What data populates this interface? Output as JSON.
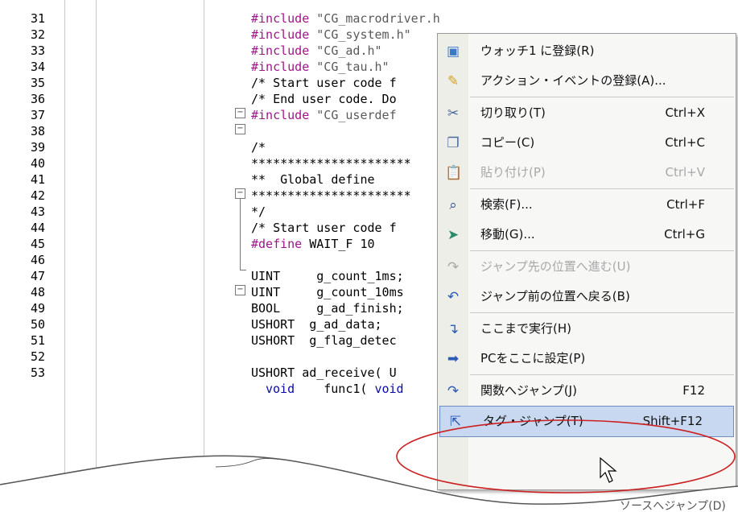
{
  "editor": {
    "lines": [
      {
        "num": "31",
        "segments": [
          {
            "t": "#include ",
            "c": "pp"
          },
          {
            "t": "\"CG_macrodriver.h\"",
            "c": "str"
          }
        ]
      },
      {
        "num": "32",
        "segments": [
          {
            "t": "#include ",
            "c": "pp"
          },
          {
            "t": "\"CG_system.h\"",
            "c": "str"
          }
        ]
      },
      {
        "num": "33",
        "segments": [
          {
            "t": "#include ",
            "c": "pp"
          },
          {
            "t": "\"CG_ad.h\"",
            "c": "str"
          }
        ]
      },
      {
        "num": "34",
        "segments": [
          {
            "t": "#include ",
            "c": "pp"
          },
          {
            "t": "\"CG_tau.h\"",
            "c": "str"
          }
        ]
      },
      {
        "num": "35",
        "segments": [
          {
            "t": "/* Start user code f",
            "c": "cmt"
          }
        ]
      },
      {
        "num": "36",
        "segments": [
          {
            "t": "/* End user code. Do",
            "c": "cmt"
          }
        ]
      },
      {
        "num": "37",
        "segments": [
          {
            "t": "#include ",
            "c": "pp"
          },
          {
            "t": "\"CG_userdef",
            "c": "str"
          }
        ]
      },
      {
        "num": "38",
        "segments": []
      },
      {
        "num": "39",
        "segments": [
          {
            "t": "/*",
            "c": "cmt"
          }
        ]
      },
      {
        "num": "40",
        "segments": [
          {
            "t": "**********************",
            "c": "cmt"
          }
        ]
      },
      {
        "num": "41",
        "segments": [
          {
            "t": "**  Global define",
            "c": "cmt"
          }
        ]
      },
      {
        "num": "42",
        "segments": [
          {
            "t": "**********************",
            "c": "cmt"
          }
        ]
      },
      {
        "num": "43",
        "segments": [
          {
            "t": "*/",
            "c": "cmt"
          }
        ]
      },
      {
        "num": "44",
        "segments": [
          {
            "t": "/* Start user code f",
            "c": "cmt"
          }
        ]
      },
      {
        "num": "45",
        "segments": [
          {
            "t": "#define ",
            "c": "pp"
          },
          {
            "t": "WAIT_F 10",
            "c": "n"
          }
        ]
      },
      {
        "num": "46",
        "segments": []
      },
      {
        "num": "47",
        "segments": [
          {
            "t": "UINT     g_count_1ms;",
            "c": "n"
          }
        ]
      },
      {
        "num": "48",
        "segments": [
          {
            "t": "UINT     g_count_10ms",
            "c": "n"
          }
        ]
      },
      {
        "num": "49",
        "segments": [
          {
            "t": "BOOL     g_ad_finish;",
            "c": "n"
          }
        ]
      },
      {
        "num": "50",
        "segments": [
          {
            "t": "USHORT  g_ad_data;",
            "c": "n"
          }
        ]
      },
      {
        "num": "51",
        "segments": [
          {
            "t": "USHORT  g_flag_detec",
            "c": "n"
          }
        ]
      },
      {
        "num": "52",
        "segments": []
      },
      {
        "num": "53",
        "segments": [
          {
            "t": "USHORT ad_receive( U",
            "c": "n"
          }
        ]
      }
    ],
    "partial_line": {
      "segments": [
        {
          "t": "void",
          "c": "kw"
        },
        {
          "t": "    func1( ",
          "c": "n"
        },
        {
          "t": "void",
          "c": "kw"
        }
      ]
    }
  },
  "context_menu": {
    "items": [
      {
        "id": "watch",
        "icon": "watch-register-icon",
        "glyph": "▣",
        "color": "#3a78c8",
        "label": "ウォッチ1 に登録(R)",
        "shortcut": "",
        "disabled": false
      },
      {
        "id": "action",
        "icon": "action-event-icon",
        "glyph": "✎",
        "color": "#d4a020",
        "label": "アクション・イベントの登録(A)...",
        "shortcut": "",
        "disabled": false
      },
      {
        "sep": true
      },
      {
        "id": "cut",
        "icon": "cut-icon",
        "glyph": "✂",
        "color": "#4a6a9a",
        "label": "切り取り(T)",
        "shortcut": "Ctrl+X",
        "disabled": false
      },
      {
        "id": "copy",
        "icon": "copy-icon",
        "glyph": "❐",
        "color": "#4a6a9a",
        "label": "コピー(C)",
        "shortcut": "Ctrl+C",
        "disabled": false
      },
      {
        "id": "paste",
        "icon": "paste-icon",
        "glyph": "📋",
        "color": "#a8a8a8",
        "label": "貼り付け(P)",
        "shortcut": "Ctrl+V",
        "disabled": true
      },
      {
        "sep": true
      },
      {
        "id": "find",
        "icon": "find-icon",
        "glyph": "⌕",
        "color": "#2a4a8a",
        "label": "検索(F)...",
        "shortcut": "Ctrl+F",
        "disabled": false
      },
      {
        "id": "goto",
        "icon": "goto-icon",
        "glyph": "➤",
        "color": "#2a8a6a",
        "label": "移動(G)...",
        "shortcut": "Ctrl+G",
        "disabled": false
      },
      {
        "sep": true
      },
      {
        "id": "forward",
        "icon": "jump-forward-icon",
        "glyph": "↷",
        "color": "#a8a8a8",
        "label": "ジャンプ先の位置へ進む(U)",
        "shortcut": "",
        "disabled": true
      },
      {
        "id": "back",
        "icon": "jump-back-icon",
        "glyph": "↶",
        "color": "#2a5ab8",
        "label": "ジャンプ前の位置へ戻る(B)",
        "shortcut": "",
        "disabled": false
      },
      {
        "sep": true
      },
      {
        "id": "runto",
        "icon": "run-to-here-icon",
        "glyph": "↴",
        "color": "#2a5ab8",
        "label": "ここまで実行(H)",
        "shortcut": "",
        "disabled": false
      },
      {
        "id": "setpc",
        "icon": "set-pc-icon",
        "glyph": "➡",
        "color": "#2a5ab8",
        "label": "PCをここに設定(P)",
        "shortcut": "",
        "disabled": false
      },
      {
        "sep": true
      },
      {
        "id": "jumpfunc",
        "icon": "jump-function-icon",
        "glyph": "↷",
        "color": "#2a5ab8",
        "label": "関数へジャンプ(J)",
        "shortcut": "F12",
        "disabled": false
      },
      {
        "id": "tagjump",
        "icon": "tag-jump-icon",
        "glyph": "⇱",
        "color": "#2a5ab8",
        "label": "タグ・ジャンプ(T)",
        "shortcut": "Shift+F12",
        "disabled": false,
        "highlighted": true
      }
    ],
    "partial_item": "ソースへジャンプ(D)"
  },
  "colors": {
    "preprocessor": "#a0148a",
    "comment": "#1a8c1a",
    "keyword": "#0a0aa8",
    "highlight_ellipse": "#cc2020",
    "menu_highlight": "#c8d8f0"
  }
}
